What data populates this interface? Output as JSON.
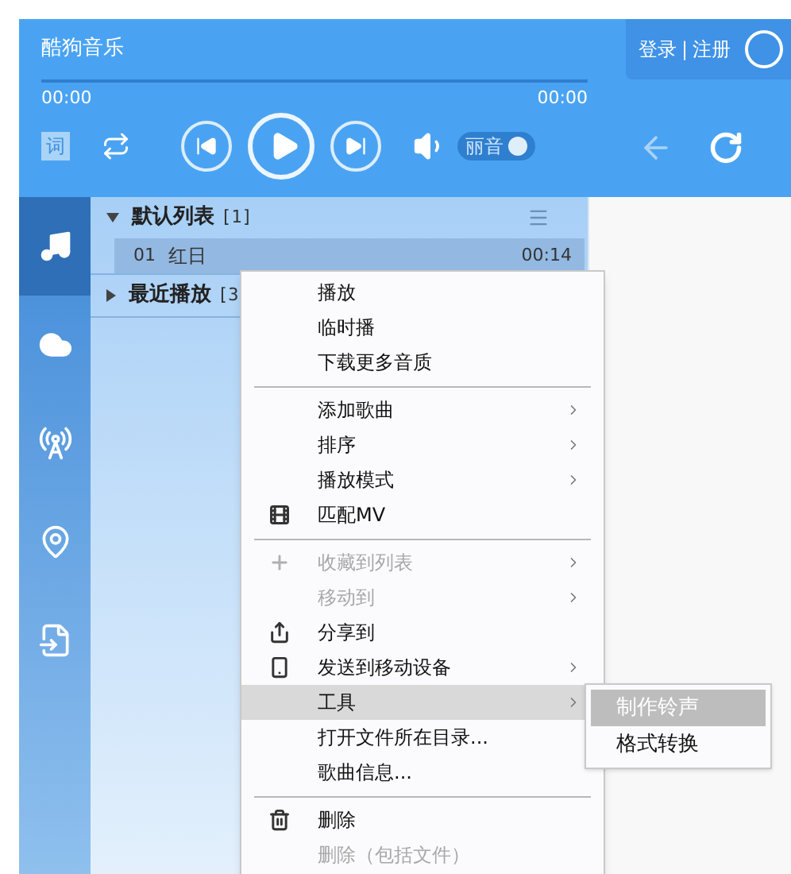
{
  "app_title": "酷狗音乐",
  "auth": {
    "login": "登录",
    "divider": "|",
    "register": "注册"
  },
  "progress": {
    "level": 0,
    "elapsed": "00:00",
    "total": "00:00"
  },
  "lyrics_button": "词",
  "playing": false,
  "sound_effect": {
    "label": "丽音",
    "on": true
  },
  "sidebar": [
    {
      "selected": true
    },
    {
      "selected": false
    },
    {
      "selected": false
    },
    {
      "selected": false
    },
    {
      "selected": false
    }
  ],
  "playlists": [
    {
      "name": "默认列表",
      "count": "[1]",
      "expanded": true,
      "songs": [
        {
          "index": "01",
          "title": "红日",
          "duration": "00:14",
          "selected": true
        }
      ]
    },
    {
      "name": "最近播放",
      "count": "[3",
      "expanded": false
    }
  ],
  "context_menu": [
    {
      "kind": "item",
      "label": "播放",
      "disabled": false,
      "submenu": false,
      "selected": false
    },
    {
      "kind": "item",
      "label": "临时播",
      "disabled": false,
      "submenu": false,
      "selected": false
    },
    {
      "kind": "item",
      "label": "下载更多音质",
      "disabled": false,
      "submenu": false,
      "selected": false
    },
    {
      "kind": "separator"
    },
    {
      "kind": "item",
      "label": "添加歌曲",
      "disabled": false,
      "submenu": true,
      "selected": false
    },
    {
      "kind": "item",
      "label": "排序",
      "disabled": false,
      "submenu": true,
      "selected": false
    },
    {
      "kind": "item",
      "label": "播放模式",
      "disabled": false,
      "submenu": true,
      "selected": false
    },
    {
      "kind": "item",
      "label": "匹配MV",
      "disabled": false,
      "submenu": false,
      "selected": false
    },
    {
      "kind": "separator"
    },
    {
      "kind": "item",
      "label": "收藏到列表",
      "disabled": true,
      "submenu": true,
      "selected": false
    },
    {
      "kind": "item",
      "label": "移动到",
      "disabled": true,
      "submenu": true,
      "selected": false
    },
    {
      "kind": "item",
      "label": "分享到",
      "disabled": false,
      "submenu": false,
      "selected": false
    },
    {
      "kind": "item",
      "label": "发送到移动设备",
      "disabled": false,
      "submenu": true,
      "selected": false
    },
    {
      "kind": "item",
      "label": "工具",
      "disabled": false,
      "submenu": true,
      "selected": true
    },
    {
      "kind": "item",
      "label": "打开文件所在目录...",
      "disabled": false,
      "submenu": false,
      "selected": false
    },
    {
      "kind": "item",
      "label": "歌曲信息...",
      "disabled": false,
      "submenu": false,
      "selected": false
    },
    {
      "kind": "separator"
    },
    {
      "kind": "item",
      "label": "删除",
      "disabled": false,
      "submenu": false,
      "selected": false
    },
    {
      "kind": "item",
      "label": "删除（包括文件）",
      "disabled": true,
      "submenu": false,
      "selected": false
    }
  ],
  "submenu": [
    {
      "label": "制作铃声",
      "selected": true
    },
    {
      "label": "格式转换",
      "selected": false
    }
  ]
}
